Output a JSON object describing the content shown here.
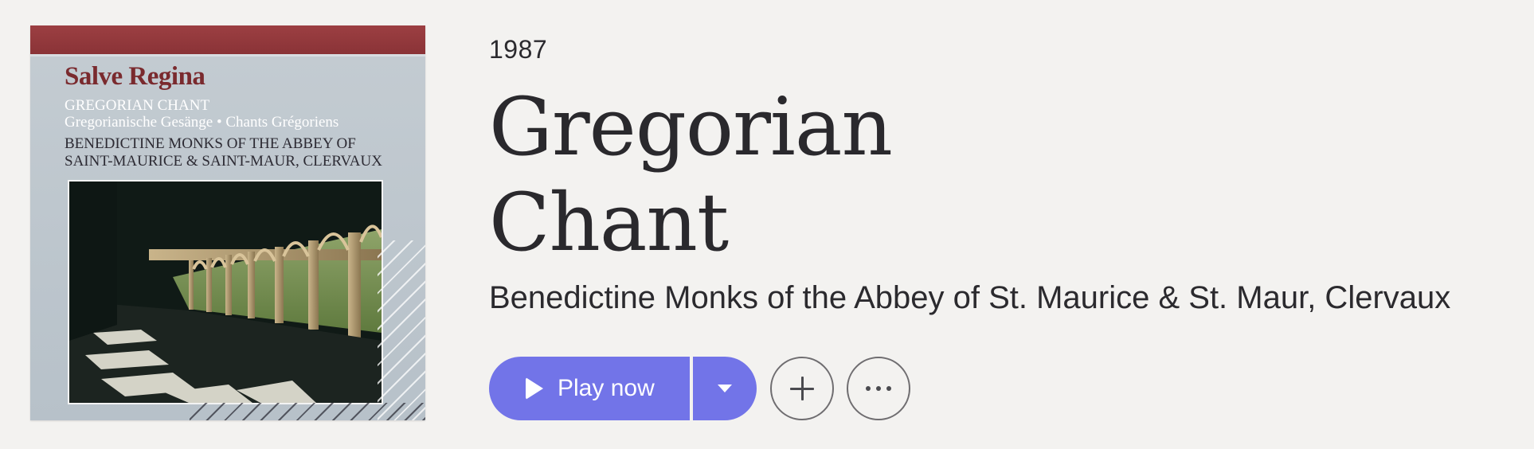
{
  "album": {
    "year": "1987",
    "title_line1": "Gregorian",
    "title_line2": "Chant",
    "artist": "Benedictine Monks of the Abbey of St. Maurice & St. Maur, Clervaux"
  },
  "cover_art": {
    "title": "Salve Regina",
    "subtitle_line1": "GREGORIAN CHANT",
    "subtitle_line2": "Gregorianische Gesänge • Chants Grégoriens",
    "artist_line1": "BENEDICTINE MONKS OF THE ABBEY OF",
    "artist_line2": "SAINT-MAURICE & SAINT-MAUR, CLERVAUX",
    "photo_icon": "cloister-photo",
    "colors": {
      "band": "#8a3337",
      "background": "#bcc5cc"
    }
  },
  "actions": {
    "play_label": "Play now",
    "play_icon": "play-icon",
    "dropdown_icon": "caret-down-icon",
    "add_icon": "plus-icon",
    "more_icon": "more-horizontal-icon"
  },
  "colors": {
    "accent": "#7274e8",
    "background": "#f3f2f0",
    "text": "#2b2a2e"
  }
}
